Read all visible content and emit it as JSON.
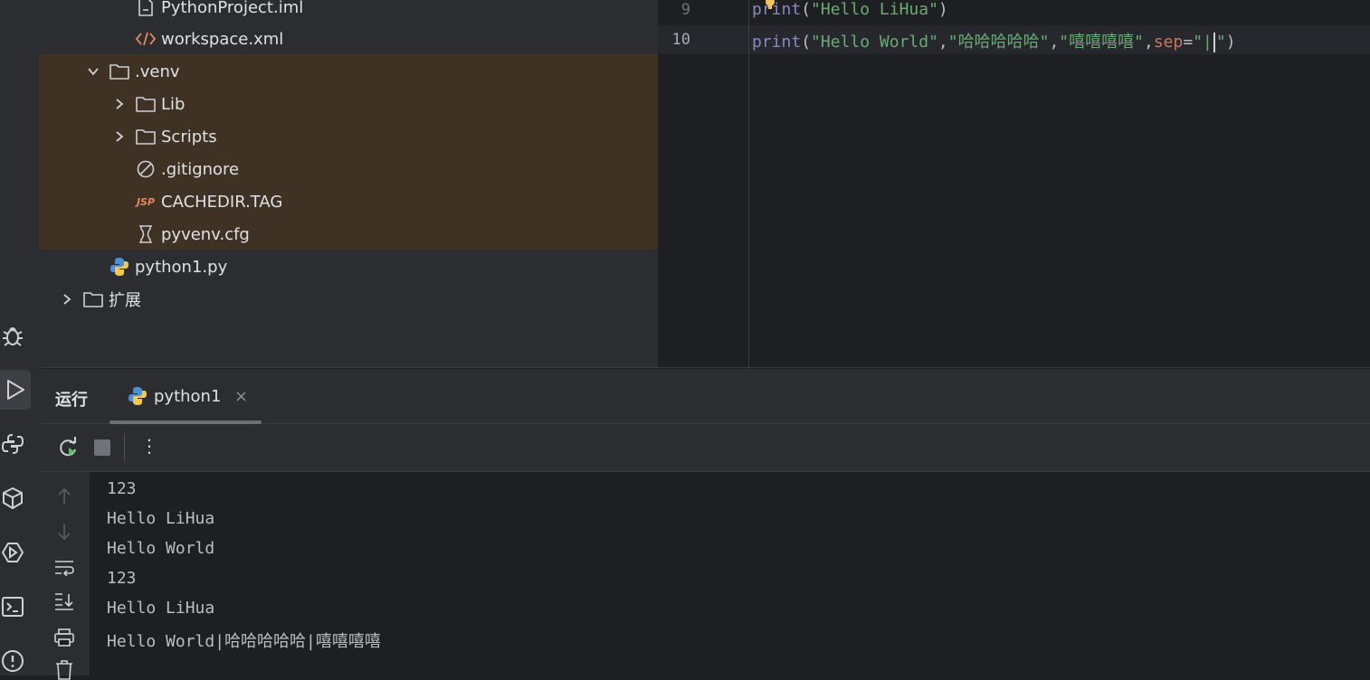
{
  "tree": {
    "items": [
      {
        "label": "PythonProject.iml",
        "icon": "module-file-icon"
      },
      {
        "label": "workspace.xml",
        "icon": "xml-file-icon"
      },
      {
        "label": ".venv",
        "icon": "folder-icon",
        "expanded": true
      },
      {
        "label": "Lib",
        "icon": "folder-icon",
        "expanded": false
      },
      {
        "label": "Scripts",
        "icon": "folder-icon",
        "expanded": false
      },
      {
        "label": ".gitignore",
        "icon": "ignore-file-icon"
      },
      {
        "label": "CACHEDIR.TAG",
        "icon": "jsp-file-icon",
        "icon_text": "JSP"
      },
      {
        "label": "pyvenv.cfg",
        "icon": "config-file-icon"
      },
      {
        "label": "python1.py",
        "icon": "python-file-icon"
      },
      {
        "label": "扩展",
        "icon": "folder-icon",
        "expanded": false
      }
    ]
  },
  "editor": {
    "lines": [
      {
        "number": "9",
        "fn": "print",
        "open": "(",
        "arg1": "\"Hello LiHua\"",
        "close": ")"
      },
      {
        "number": "10",
        "fn": "print",
        "open": "(",
        "arg1": "\"Hello World\"",
        "comma1": ",",
        "arg2": "\"哈哈哈哈哈\"",
        "comma2": ",",
        "arg3": "\"嘻嘻嘻嘻\"",
        "comma3": ",",
        "param": "sep",
        "eq": "=",
        "quote_open": "\"",
        "sep_value": "|",
        "quote_close": "\"",
        "close": ")"
      }
    ]
  },
  "run": {
    "title": "运行",
    "tab_label": "python1",
    "tab_close": "×",
    "toolbar_more": "⋮"
  },
  "console": {
    "lines": [
      "123",
      "Hello LiHua",
      "Hello World",
      "123",
      "Hello LiHua",
      "Hello World|哈哈哈哈哈|嘻嘻嘻嘻"
    ]
  },
  "colors": {
    "venv_highlight": "#3f3225",
    "string": "#6aab73",
    "function": "#8888c6",
    "param": "#c77b5a"
  }
}
